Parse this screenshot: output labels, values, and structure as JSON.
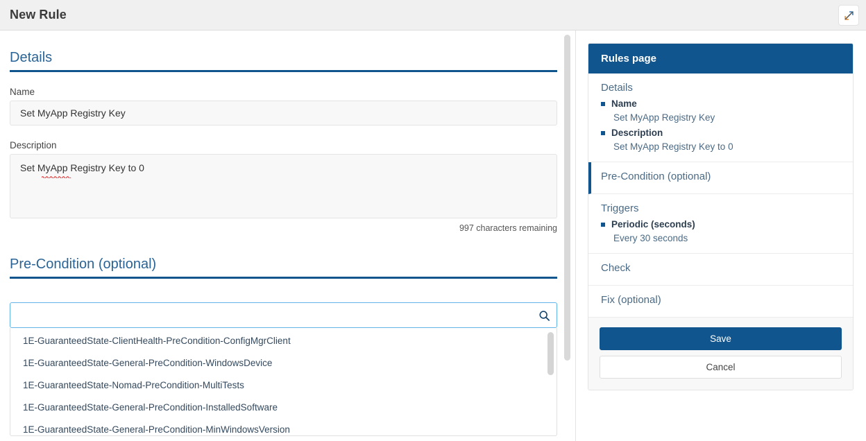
{
  "header": {
    "title": "New Rule",
    "expand_icon": "expand-diagonal-icon"
  },
  "form": {
    "details_heading": "Details",
    "name_label": "Name",
    "name_value": "Set MyApp Registry Key",
    "name_placeholder": "",
    "description_label": "Description",
    "description_value": "Set MyApp Registry Key to 0",
    "description_placeholder": "",
    "char_count": "997 characters remaining",
    "precondition_heading": "Pre-Condition (optional)",
    "search_value": "",
    "search_placeholder": "",
    "search_icon": "search-icon",
    "dropdown_items": [
      "1E-GuaranteedState-ClientHealth-PreCondition-ConfigMgrClient",
      "1E-GuaranteedState-General-PreCondition-WindowsDevice",
      "1E-GuaranteedState-Nomad-PreCondition-MultiTests",
      "1E-GuaranteedState-General-PreCondition-InstalledSoftware",
      "1E-GuaranteedState-General-PreCondition-MinWindowsVersion"
    ]
  },
  "sidebar": {
    "card_title": "Rules page",
    "sections": [
      {
        "title": "Details",
        "active": false,
        "rows": [
          {
            "key": "Name",
            "value": "Set MyApp Registry Key"
          },
          {
            "key": "Description",
            "value": "Set MyApp Registry Key to 0"
          }
        ]
      },
      {
        "title": "Pre-Condition (optional)",
        "active": true,
        "rows": []
      },
      {
        "title": "Triggers",
        "active": false,
        "rows": [
          {
            "key": "Periodic (seconds)",
            "value": "Every 30 seconds"
          }
        ]
      },
      {
        "title": "Check",
        "active": false,
        "rows": []
      },
      {
        "title": "Fix (optional)",
        "active": false,
        "rows": []
      }
    ],
    "save_label": "Save",
    "cancel_label": "Cancel"
  },
  "colors": {
    "brand_blue": "#10558d",
    "heading_blue": "#2a6496",
    "focus_blue": "#61b3e8",
    "header_bg": "#f0f0f0",
    "input_bg": "#f8f8f8"
  }
}
